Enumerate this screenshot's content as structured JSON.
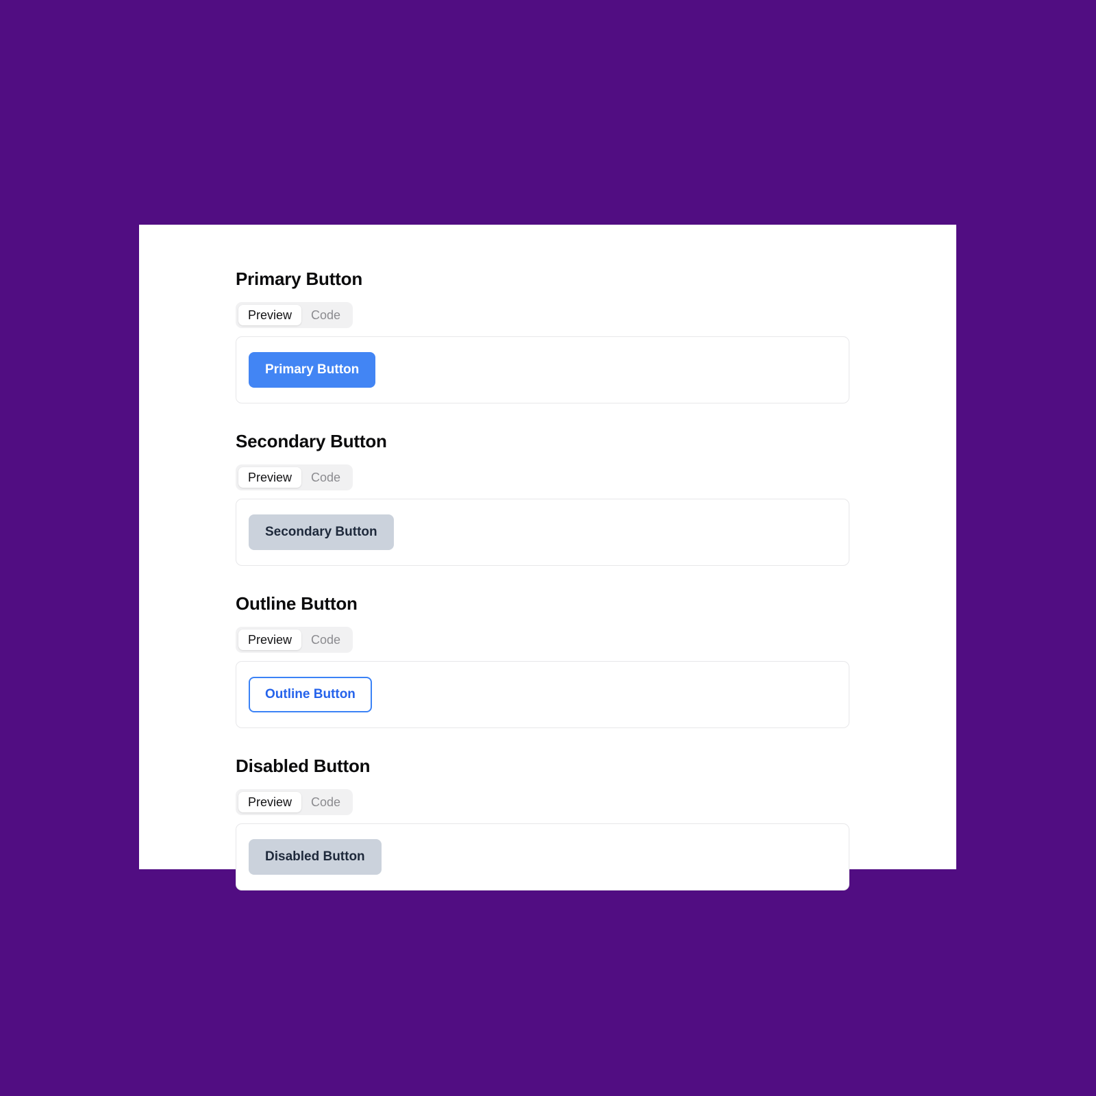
{
  "theme": {
    "page_background": "#510d82",
    "card_background": "#ffffff",
    "primary_color": "#4285f4",
    "secondary_color": "#cbd2dc",
    "outline_border_color": "#3b82f6",
    "outline_text_color": "#2563eb",
    "muted_text_color": "#8b8b8f",
    "heading_color": "#0b0b0c",
    "box_border_color": "#e7e7e9",
    "tab_group_background": "#f1f1f2"
  },
  "sections": [
    {
      "heading": "Primary Button",
      "tabs": [
        {
          "label": "Preview",
          "active": true
        },
        {
          "label": "Code",
          "active": false
        }
      ],
      "demo": {
        "label": "Primary Button",
        "variant": "primary"
      }
    },
    {
      "heading": "Secondary Button",
      "tabs": [
        {
          "label": "Preview",
          "active": true
        },
        {
          "label": "Code",
          "active": false
        }
      ],
      "demo": {
        "label": "Secondary Button",
        "variant": "secondary"
      }
    },
    {
      "heading": "Outline Button",
      "tabs": [
        {
          "label": "Preview",
          "active": true
        },
        {
          "label": "Code",
          "active": false
        }
      ],
      "demo": {
        "label": "Outline Button",
        "variant": "outline"
      }
    },
    {
      "heading": "Disabled Button",
      "tabs": [
        {
          "label": "Preview",
          "active": true
        },
        {
          "label": "Code",
          "active": false
        }
      ],
      "demo": {
        "label": "Disabled Button",
        "variant": "disabled"
      }
    }
  ]
}
